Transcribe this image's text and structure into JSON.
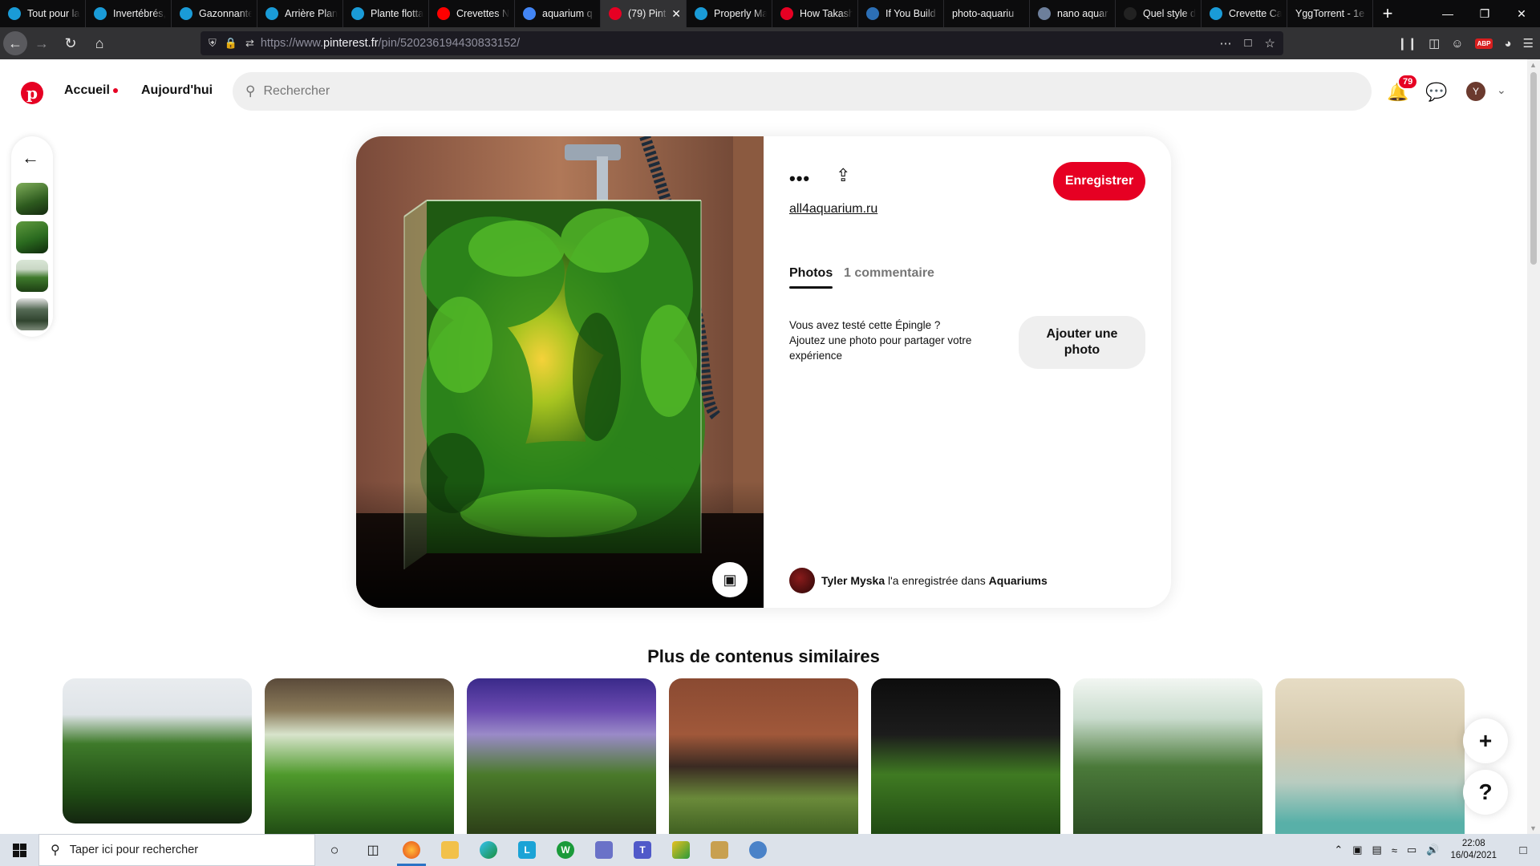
{
  "browser": {
    "tabs": [
      {
        "label": "Tout pour la",
        "color": "#1a9bd7",
        "active": false
      },
      {
        "label": "Invertébrés,",
        "color": "#1a9bd7",
        "active": false
      },
      {
        "label": "Gazonnante",
        "color": "#1a9bd7",
        "active": false
      },
      {
        "label": "Arrière Plan",
        "color": "#1a9bd7",
        "active": false
      },
      {
        "label": "Plante flotta",
        "color": "#1a9bd7",
        "active": false
      },
      {
        "label": "Crevettes N",
        "color": "#ff0000",
        "active": false
      },
      {
        "label": "aquarium q",
        "color": "#4285f4",
        "active": false
      },
      {
        "label": "(79) Pint",
        "color": "#e60023",
        "active": true
      },
      {
        "label": "Properly Ma",
        "color": "#1a9bd7",
        "active": false
      },
      {
        "label": "How Takash",
        "color": "#e60023",
        "active": false
      },
      {
        "label": "If You Build",
        "color": "#2c6fb5",
        "active": false
      },
      {
        "label": "photo-aquariu",
        "color": "",
        "active": false
      },
      {
        "label": "nano aquar",
        "color": "#6d7f9b",
        "active": false
      },
      {
        "label": "Quel style d",
        "color": "#222222",
        "active": false
      },
      {
        "label": "Crevette Ca",
        "color": "#1a9bd7",
        "active": false
      },
      {
        "label": "YggTorrent - 1e",
        "color": "",
        "active": false
      }
    ],
    "url_scheme": "https://www.",
    "url_host": "pinterest.fr",
    "url_path": "/pin/520236194430833152/"
  },
  "header": {
    "nav_home": "Accueil",
    "nav_today": "Aujourd'hui",
    "search_placeholder": "Rechercher",
    "notification_count": "79",
    "avatar_initial": "Y"
  },
  "pin": {
    "save_label": "Enregistrer",
    "source": "all4aquarium.ru",
    "tab_photos": "Photos",
    "tab_comments": "1 commentaire",
    "tried_line1": "Vous avez testé cette Épingle ?",
    "tried_line2": "Ajoutez une photo pour partager votre expérience",
    "add_photo_label": "Ajouter une photo",
    "saver_name": "Tyler Myska",
    "saver_text": "l'a enregistrée dans",
    "board_name": "Aquariums"
  },
  "similar": {
    "title": "Plus de contenus similaires"
  },
  "fabs": {
    "plus": "+",
    "help": "?"
  },
  "taskbar": {
    "search_placeholder": "Taper ici pour rechercher",
    "time": "22:08",
    "date": "16/04/2021"
  }
}
